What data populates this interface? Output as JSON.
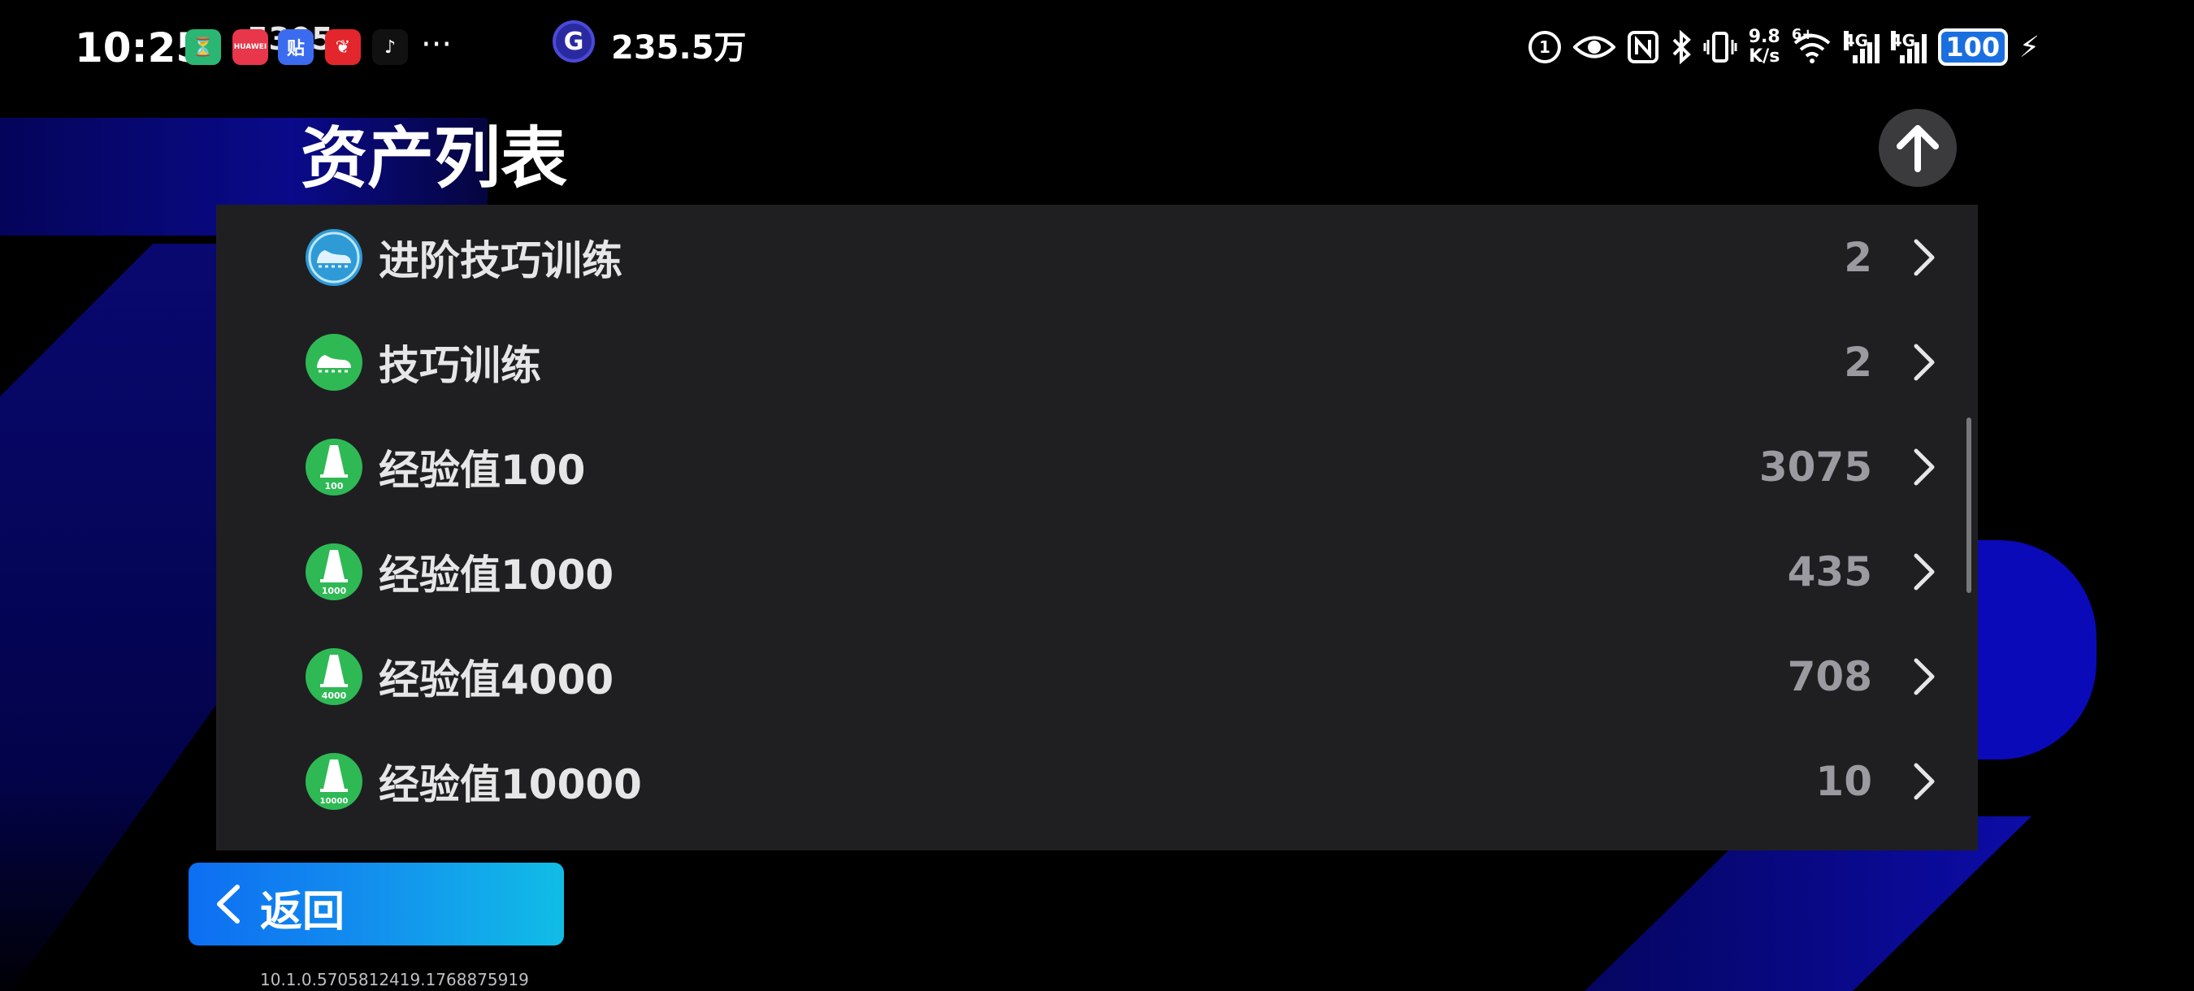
{
  "status_bar": {
    "time": "10:25",
    "notification_count": "5305",
    "app_icons": [
      {
        "name": "timer-app-icon",
        "glyph": "⏳",
        "color": "#2bb673"
      },
      {
        "name": "huawei-app-icon",
        "glyph": "HUAWEI",
        "color": "#e8364a"
      },
      {
        "name": "tieba-app-icon",
        "glyph": "贴",
        "color": "#3b6cf0"
      },
      {
        "name": "red-app-icon",
        "glyph": "❦",
        "color": "#e3262b"
      },
      {
        "name": "tiktok-app-icon",
        "glyph": "♪",
        "color": "#111111"
      }
    ],
    "more": "···",
    "coin_letter": "G",
    "coin_count": "235.5万",
    "net_speed_value": "9.8",
    "net_speed_unit": "K/s",
    "wifi_label": "6+",
    "signal1_label": "4G",
    "signal2_label": "4G",
    "battery": "100"
  },
  "header": {
    "title": "资产列表"
  },
  "assets": [
    {
      "name": "进阶技巧训练",
      "count": "2",
      "icon": "advanced-shoe-icon",
      "icon_color": "#2e9bd6",
      "badge": ""
    },
    {
      "name": "技巧训练",
      "count": "2",
      "icon": "shoe-icon",
      "icon_color": "#2fb954",
      "badge": ""
    },
    {
      "name": "经验值100",
      "count": "3075",
      "icon": "cone-icon",
      "icon_color": "#2fb954",
      "badge": "100"
    },
    {
      "name": "经验值1000",
      "count": "435",
      "icon": "cone-icon",
      "icon_color": "#2fb954",
      "badge": "1000"
    },
    {
      "name": "经验值4000",
      "count": "708",
      "icon": "cone-icon",
      "icon_color": "#2fb954",
      "badge": "4000"
    },
    {
      "name": "经验值10000",
      "count": "10",
      "icon": "cone-icon",
      "icon_color": "#2fb954",
      "badge": "10000"
    }
  ],
  "footer": {
    "back_label": "返回",
    "version": "10.1.0.5705812419.1768875919"
  }
}
